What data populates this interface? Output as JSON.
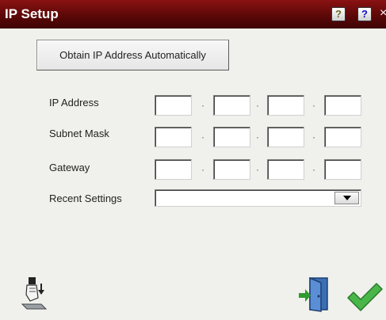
{
  "window": {
    "title": "IP Setup",
    "hint_glyph": "?",
    "help_glyph": "?",
    "close_glyph": "×"
  },
  "actions": {
    "obtain_label": "Obtain IP Address Automatically"
  },
  "fields": {
    "ip_address": {
      "label": "IP Address",
      "octets": [
        "",
        "",
        "",
        ""
      ]
    },
    "subnet_mask": {
      "label": "Subnet Mask",
      "octets": [
        "",
        "",
        "",
        ""
      ]
    },
    "gateway": {
      "label": "Gateway",
      "octets": [
        "",
        "",
        "",
        ""
      ]
    },
    "recent_settings": {
      "label": "Recent Settings",
      "selected": ""
    }
  },
  "separator": "·",
  "icons": {
    "transfer": "hand-drive-transfer-icon",
    "exit": "exit-door-icon",
    "accept": "green-checkmark-icon"
  }
}
